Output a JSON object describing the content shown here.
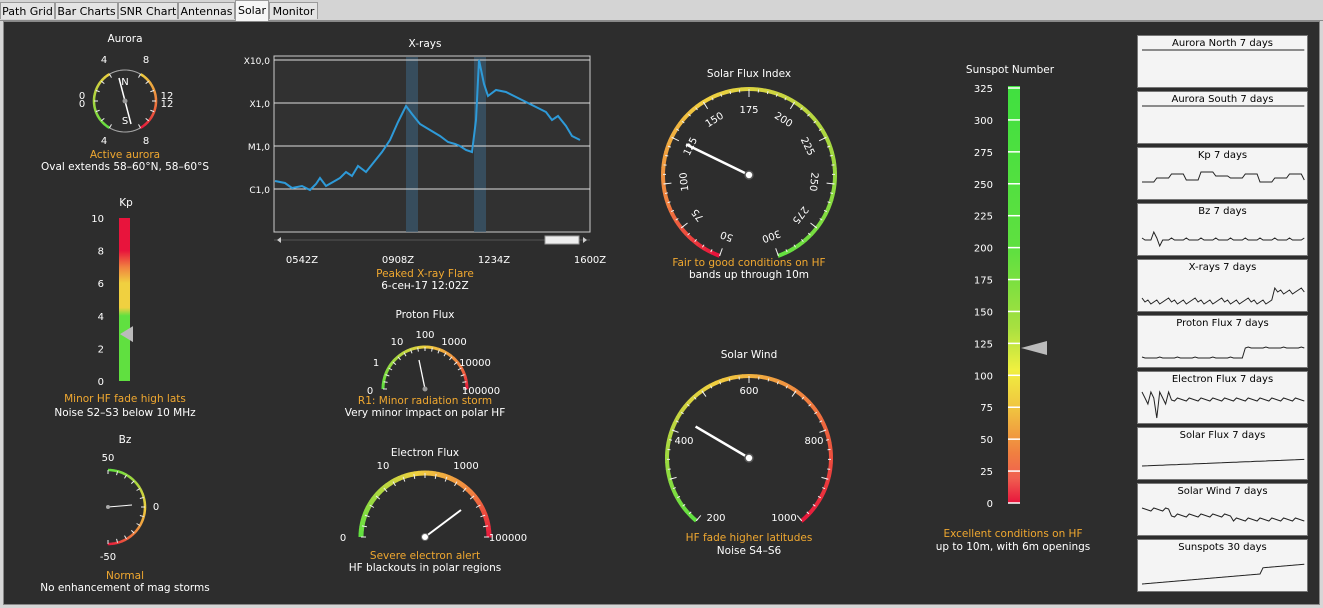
{
  "tabs": [
    {
      "label": "Path Grid",
      "active": false
    },
    {
      "label": "Bar Charts",
      "active": false
    },
    {
      "label": "SNR Chart",
      "active": false
    },
    {
      "label": "Antennas",
      "active": false
    },
    {
      "label": "Solar",
      "active": true
    },
    {
      "label": "Monitor",
      "active": false
    }
  ],
  "aurora": {
    "title": "Aurora",
    "status": "Active aurora",
    "detail": "Oval extends 58–60°N, 58–60°S",
    "scale_top": [
      "4",
      "8"
    ],
    "scale_bottom": [
      "4",
      "8"
    ],
    "scale_left": [
      "0",
      "0"
    ],
    "scale_right": [
      "12",
      "12"
    ],
    "north": "N",
    "south": "S"
  },
  "kp": {
    "title": "Kp",
    "ticks": [
      "10",
      "8",
      "6",
      "4",
      "2",
      "0"
    ],
    "value": 3,
    "status": "Minor HF fade high lats",
    "detail": "Noise S2–S3 below 10 MHz"
  },
  "bz": {
    "title": "Bz",
    "top": "50",
    "mid": "0",
    "bottom": "-50",
    "status": "Normal",
    "detail": "No enhancement of mag storms"
  },
  "xrays": {
    "title": "X-rays",
    "levels": [
      "X10,0",
      "X1,0",
      "M1,0",
      "C1,0"
    ],
    "times": [
      "0542Z",
      "0908Z",
      "1234Z",
      "1600Z"
    ],
    "status": "Peaked X-ray Flare",
    "detail": "6-сен-17 12:02Z"
  },
  "proton": {
    "title": "Proton Flux",
    "labels": [
      "0",
      "1",
      "10",
      "100",
      "1000",
      "10000",
      "100000"
    ],
    "status": "R1: Minor radiation storm",
    "detail": "Very minor impact on polar HF"
  },
  "electron": {
    "title": "Electron Flux",
    "labels": [
      "0",
      "10",
      "1000",
      "100000"
    ],
    "status": "Severe electron alert",
    "detail": "HF blackouts in polar regions"
  },
  "sfi": {
    "title": "Solar Flux Index",
    "labels": [
      "50",
      "75",
      "100",
      "125",
      "150",
      "175",
      "200",
      "225",
      "250",
      "275",
      "300"
    ],
    "value": 125,
    "status": "Fair to good conditions on HF",
    "detail": "bands up through 10m"
  },
  "wind": {
    "title": "Solar Wind",
    "labels": [
      "200",
      "400",
      "600",
      "800",
      "1000"
    ],
    "value": 430,
    "status": "HF fade higher latitudes",
    "detail": "Noise S4–S6"
  },
  "sunspot": {
    "title": "Sunspot Number",
    "ticks": [
      "325",
      "300",
      "275",
      "250",
      "225",
      "200",
      "175",
      "150",
      "125",
      "100",
      "75",
      "50",
      "25",
      "0"
    ],
    "value": 123,
    "status": "Excellent conditions on HF",
    "detail": "up to 10m, with 6m openings"
  },
  "minis": [
    "Aurora North 7 days",
    "Aurora South 7 days",
    "Kp 7 days",
    "Bz 7 days",
    "X-rays 7 days",
    "Proton Flux 7 days",
    "Electron Flux 7 days",
    "Solar Flux 7 days",
    "Solar Wind 7 days",
    "Sunspots 30 days"
  ],
  "colors": {
    "red": "#e8143c",
    "orange": "#f08040",
    "yellow": "#f0d040",
    "green": "#60e040",
    "accent": "#f0a830",
    "line": "#2e9ad8"
  }
}
